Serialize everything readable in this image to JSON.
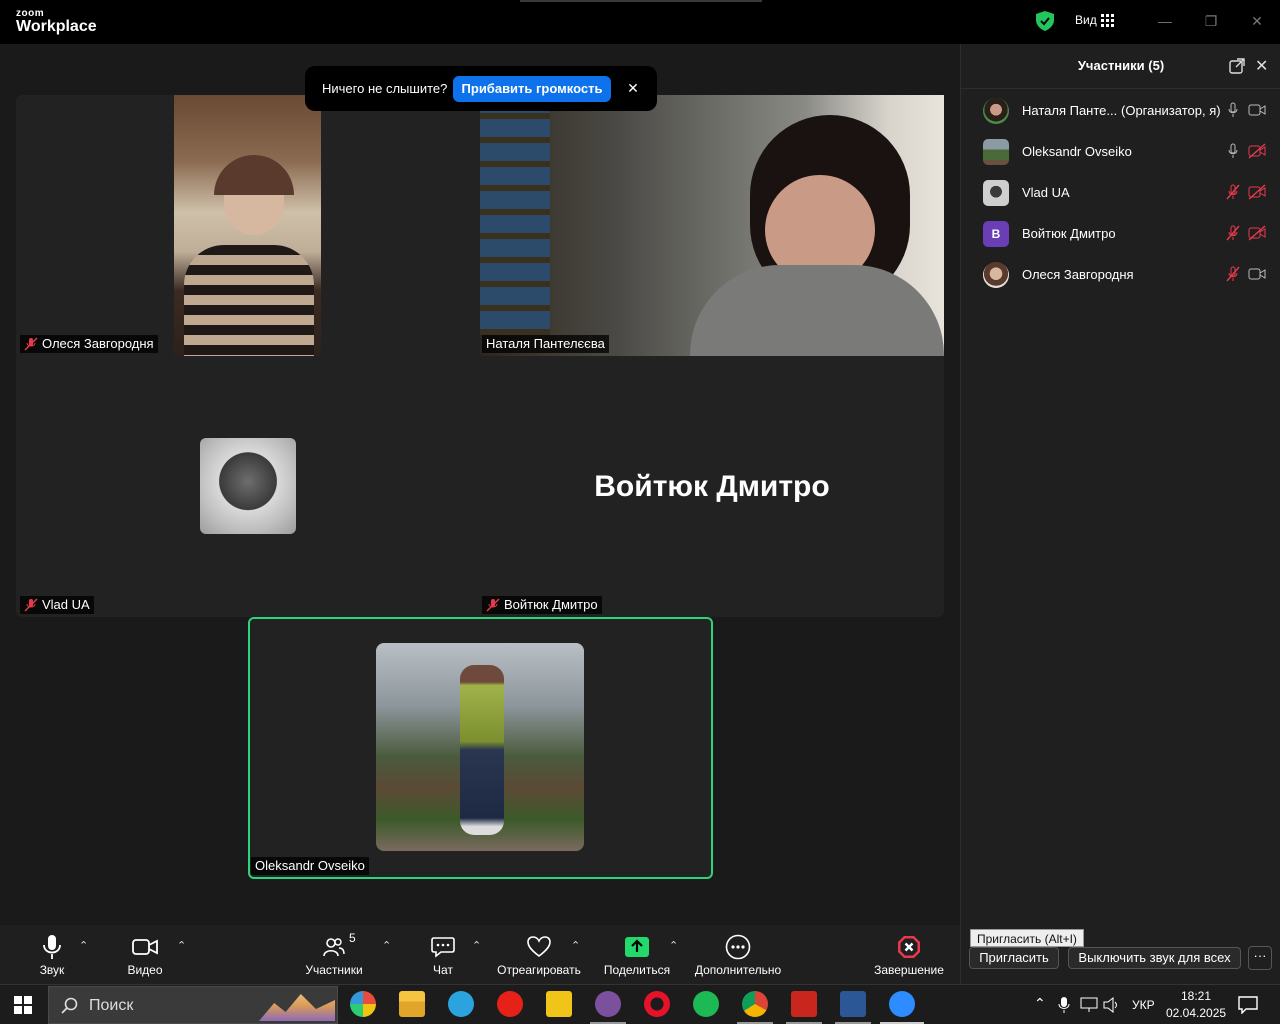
{
  "app": {
    "logo_small": "zoom",
    "logo_large": "Workplace",
    "view_label": "Вид",
    "minimize": "—",
    "restore": "❐",
    "close": "✕"
  },
  "notification": {
    "text": "Ничего не слышите?",
    "button": "Прибавить громкость",
    "close": "✕"
  },
  "tiles": {
    "olesya": "Олеся Завгородня",
    "natalia": "Наталя Пантелєєва",
    "vlad": "Vlad UA",
    "voitiuk": "Войтюк Дмитро",
    "voitiuk_big": "Войтюк Дмитро",
    "oleksandr": "Oleksandr Ovseiko"
  },
  "panel": {
    "title": "Участники (5)",
    "participants": [
      {
        "name": "Наталя Панте...",
        "role": "(Организатор, я)",
        "mic": "on",
        "cam": "on"
      },
      {
        "name": "Oleksandr Ovseiko",
        "role": "",
        "mic": "on",
        "cam": "off"
      },
      {
        "name": "Vlad UA",
        "role": "",
        "mic": "off",
        "cam": "off"
      },
      {
        "name": "Войтюк Дмитро",
        "role": "",
        "mic": "off",
        "cam": "off",
        "initial": "B"
      },
      {
        "name": "Олеся Завгородня",
        "role": "",
        "mic": "off",
        "cam": "on"
      }
    ],
    "tooltip": "Пригласить (Alt+I)",
    "invite": "Пригласить",
    "mute_all": "Выключить звук для всех",
    "more": "···"
  },
  "toolbar": {
    "audio": "Звук",
    "video": "Видео",
    "participants": "Участники",
    "participants_count": "5",
    "chat": "Чат",
    "react": "Отреагировать",
    "share": "Поделиться",
    "more": "Дополнительно",
    "end": "Завершение"
  },
  "taskbar": {
    "search": "Поиск",
    "lang": "УКР",
    "time": "18:21",
    "date": "02.04.2025"
  },
  "colors": {
    "accent_blue": "#0e72ed",
    "active_speaker": "#2ed47a",
    "mute_red": "#e8394c",
    "share_green": "#23d96b"
  }
}
